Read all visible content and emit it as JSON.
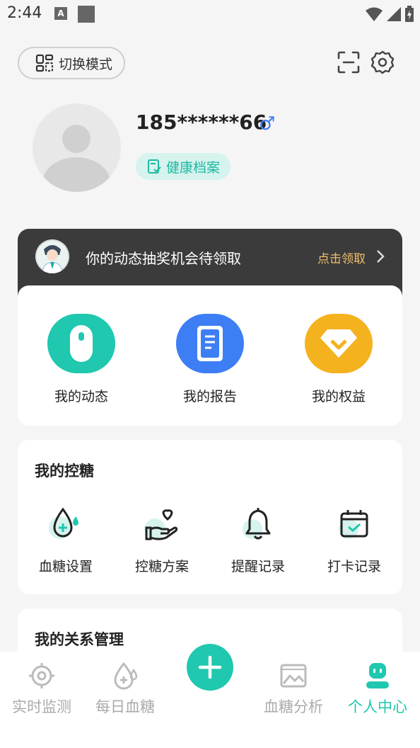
{
  "status_bar": {
    "time": "2:44",
    "a_glyph": "A"
  },
  "header": {
    "mode_label": "切换模式"
  },
  "profile": {
    "phone": "185******66",
    "gender_symbol": "♂",
    "health_record_label": "健康档案"
  },
  "promo": {
    "text": "你的动态抽奖机会待领取",
    "link": "点击领取"
  },
  "quick_actions": [
    {
      "label": "我的动态",
      "color": "#1fc8ae"
    },
    {
      "label": "我的报告",
      "color": "#3d7ef5"
    },
    {
      "label": "我的权益",
      "color": "#f5b21f"
    }
  ],
  "sugar_control": {
    "title": "我的控糖",
    "items": [
      {
        "label": "血糖设置",
        "icon": "drop-plus-icon"
      },
      {
        "label": "控糖方案",
        "icon": "hand-heart-icon"
      },
      {
        "label": "提醒记录",
        "icon": "bell-icon"
      },
      {
        "label": "打卡记录",
        "icon": "calendar-check-icon"
      }
    ]
  },
  "relations": {
    "title": "我的关系管理"
  },
  "tabbar": {
    "items": [
      {
        "label": "实时监测"
      },
      {
        "label": "每日血糖"
      },
      {
        "label": "血糖分析"
      },
      {
        "label": "个人中心"
      }
    ],
    "accent": "#1fc8ae"
  }
}
